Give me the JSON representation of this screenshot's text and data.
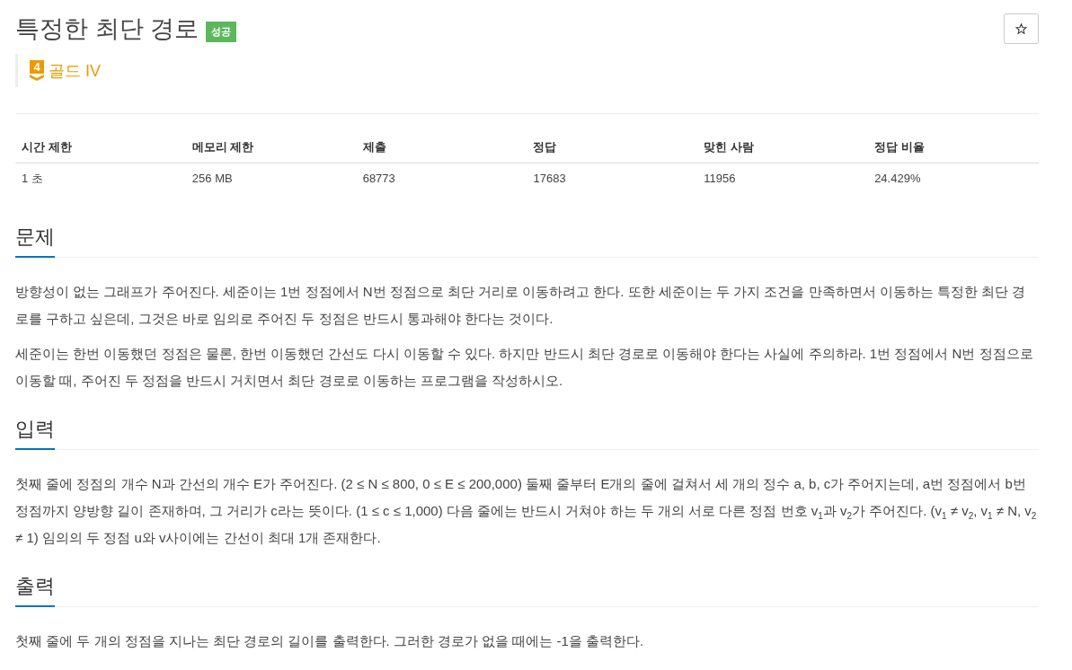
{
  "problem": {
    "title": "특정한 최단 경로",
    "result_badge": "성공",
    "tier": {
      "number": "4",
      "label": "골드 IV"
    }
  },
  "info_table": {
    "columns": [
      "시간 제한",
      "메모리 제한",
      "제출",
      "정답",
      "맞힌 사람",
      "정답 비율"
    ],
    "rows": [
      [
        "1 초",
        "256 MB",
        "68773",
        "17683",
        "11956",
        "24.429%"
      ]
    ]
  },
  "sections": [
    {
      "heading": "문제",
      "paragraphs": [
        "방향성이 없는 그래프가 주어진다. 세준이는 1번 정점에서 N번 정점으로 최단 거리로 이동하려고 한다. 또한 세준이는 두 가지 조건을 만족하면서 이동하는 특정한 최단 경로를 구하고 싶은데, 그것은 바로 임의로 주어진 두 정점은 반드시 통과해야 한다는 것이다.",
        "세준이는 한번 이동했던 정점은 물론, 한번 이동했던 간선도 다시 이동할 수 있다. 하지만 반드시 최단 경로로 이동해야 한다는 사실에 주의하라. 1번 정점에서 N번 정점으로 이동할 때, 주어진 두 정점을 반드시 거치면서 최단 경로로 이동하는 프로그램을 작성하시오."
      ]
    },
    {
      "heading": "입력",
      "paragraphs": [
        "첫째 줄에 정점의 개수 N과 간선의 개수 E가 주어진다. (2 ≤ N ≤ 800, 0 ≤ E ≤ 200,000) 둘째 줄부터 E개의 줄에 걸쳐서 세 개의 정수 a, b, c가 주어지는데, a번 정점에서 b번 정점까지 양방향 길이 존재하며, 그 거리가 c라는 뜻이다. (1 ≤ c ≤ 1,000) 다음 줄에는 반드시 거쳐야 하는 두 개의 서로 다른 정점 번호 v$_{1}$과 v$_{2}$가 주어진다. (v$_{1}$ ≠ v$_{2}$, v$_{1}$ ≠ N, v$_{2}$ ≠ 1) 임의의 두 정점 u와 v사이에는 간선이 최대 1개 존재한다."
      ]
    },
    {
      "heading": "출력",
      "paragraphs": [
        "첫째 줄에 두 개의 정점을 지나는 최단 경로의 길이를 출력한다. 그러한 경로가 없을 때에는 -1을 출력한다."
      ]
    }
  ]
}
